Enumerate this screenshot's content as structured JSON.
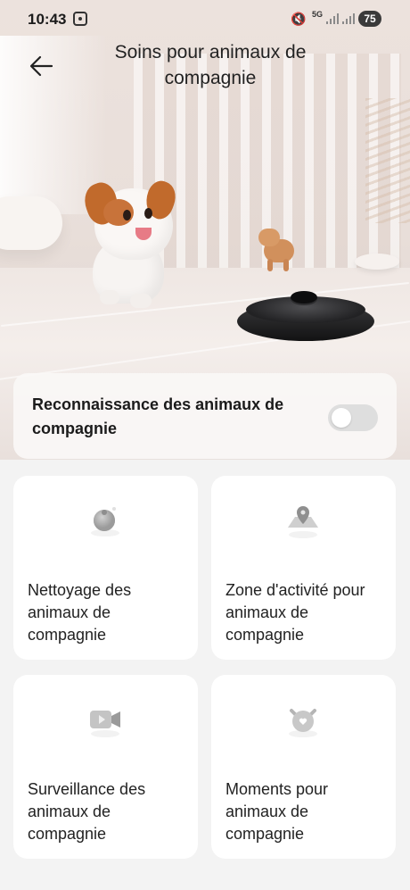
{
  "status_bar": {
    "time": "10:43",
    "network": "5G",
    "battery": "75"
  },
  "header": {
    "title": "Soins pour animaux de compagnie"
  },
  "pet_recognition": {
    "label": "Reconnaissance des animaux de compagnie",
    "enabled": false
  },
  "features": [
    {
      "label": "Nettoyage des animaux de compagnie",
      "icon": "robot-vacuum-icon"
    },
    {
      "label": "Zone d'activité pour animaux de compagnie",
      "icon": "map-pin-icon"
    },
    {
      "label": "Surveillance des animaux de compagnie",
      "icon": "video-camera-icon"
    },
    {
      "label": "Moments pour animaux de compagnie",
      "icon": "cat-face-icon"
    }
  ],
  "colors": {
    "card_bg": "#ffffff",
    "page_bg": "#f3f3f3",
    "toggle_off": "#dedede",
    "text": "#222222"
  }
}
